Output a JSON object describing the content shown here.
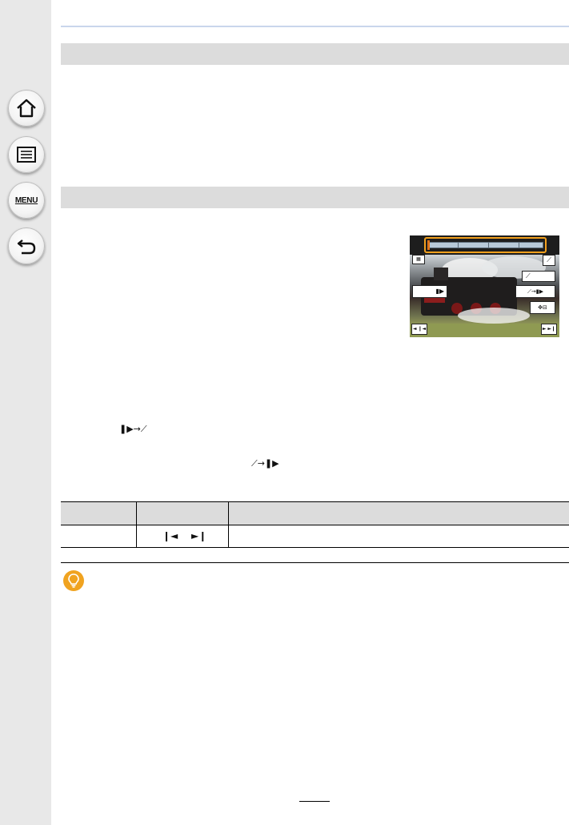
{
  "sidebar": {
    "buttons": [
      {
        "name": "home",
        "icon": "home-icon"
      },
      {
        "name": "contents",
        "icon": "list-icon"
      },
      {
        "name": "menu",
        "icon": "menu-icon",
        "label": "MENU"
      },
      {
        "name": "back",
        "icon": "back-arrow-icon"
      }
    ]
  },
  "preview": {
    "icons": [
      "timeline",
      "scene-icon",
      "mark-icon",
      "clip-icon",
      "mark-to-clip-icon",
      "cursor-icon",
      "prev-icon",
      "next-icon"
    ],
    "labels": {
      "prev": "◄ ❙◄",
      "next": "► ►❙"
    }
  },
  "inline_glyphs": {
    "clip_to_mark": "❚▶→⟋",
    "mark_to_clip": "⟋→❚▶"
  },
  "table": {
    "row_glyphs": {
      "prev": "❙◄",
      "next": "►❙"
    }
  },
  "colors": {
    "section_bar": "#dcdcdc",
    "accent_orange": "#f0a320",
    "top_rule": "#c9d6ec",
    "sidebar_bg": "#e8e8e8"
  }
}
